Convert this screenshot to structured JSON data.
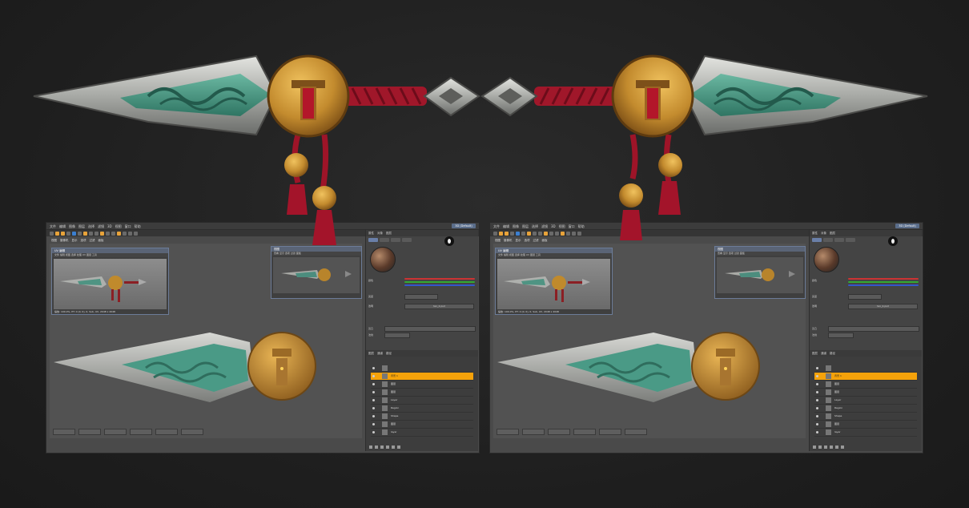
{
  "app": {
    "menu": [
      "文件",
      "编辑",
      "图像",
      "图层",
      "选择",
      "滤镜",
      "3D",
      "视图",
      "窗口",
      "帮助"
    ],
    "layout_label": "3D (Default)"
  },
  "viewport": {
    "tabs": [
      "视图",
      "摄像机",
      "显示",
      "选项",
      "过滤",
      "面板"
    ]
  },
  "sub_windows": {
    "render": {
      "title": "UV 编辑",
      "menu": "文件 编辑 视图 选择 纹理 UV 图层 工具",
      "status": "缩放: 100.0%, PT: 0 (0, 0), 0, Sub, UV, 2048 x 2048"
    },
    "preview": {
      "title": "视图",
      "menu": "查看 显示 选项 过滤 面板"
    }
  },
  "panel": {
    "header": [
      "属性",
      "对象",
      "图层"
    ],
    "section_labels": [
      "颜色",
      "亮度",
      "透明",
      "凹凸",
      "法线"
    ],
    "texture_name": "tex_2.psd",
    "layers_header": [
      "图层",
      "通道",
      "路径"
    ],
    "layers": [
      {
        "name": ""
      },
      {
        "name": "背景 1",
        "selected": true
      },
      {
        "name": "图层"
      },
      {
        "name": "图层"
      },
      {
        "name": "Layer"
      },
      {
        "name": "Region"
      },
      {
        "name": "Shape"
      },
      {
        "name": "图层"
      },
      {
        "name": "layer"
      }
    ]
  },
  "colors": {
    "selection": "#f5a20a",
    "accent": "#e8a33a",
    "window_bg": "#4a4a4a"
  }
}
